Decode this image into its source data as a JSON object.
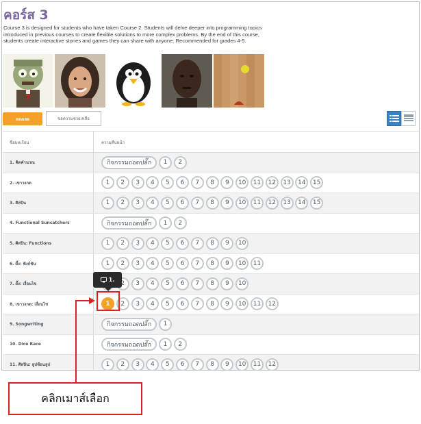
{
  "course": {
    "title": "คอร์ส 3",
    "description": "Course 3 is designed for students who have taken Course 2. Students will delve deeper into programming topics introduced in previous courses to create flexible solutions to more complex problems. By the end of this course, students create interactive stories and games they can share with anyone. Recommended for grades 4-5."
  },
  "images": [
    "zombie",
    "woman-portrait",
    "penguin",
    "man-portrait",
    "wooden-board-ball"
  ],
  "buttons": {
    "try_now": "ลองเลย",
    "help": "ขอความช่วยเหลือ"
  },
  "view_toggle": {
    "active": "list-view-icon",
    "inactive": "detail-view-icon"
  },
  "table": {
    "headers": [
      "ชื่อบทเรียน",
      "ความคืบหน้า"
    ],
    "rows": [
      {
        "name": "1. คิดคำนวณ",
        "unplugged": "กิจกรรมถอดปลั๊ก",
        "levels": [
          "1",
          "2"
        ]
      },
      {
        "name": "2. เขาวงกต",
        "levels": [
          "1",
          "2",
          "3",
          "4",
          "5",
          "6",
          "7",
          "8",
          "9",
          "10",
          "11",
          "12",
          "13",
          "14",
          "15"
        ]
      },
      {
        "name": "3. ศิลปิน",
        "levels": [
          "1",
          "2",
          "3",
          "4",
          "5",
          "6",
          "7",
          "8",
          "9",
          "10",
          "11",
          "12",
          "13",
          "14",
          "15"
        ]
      },
      {
        "name": "4. Functional Suncatchers",
        "unplugged": "กิจกรรมถอดปลั๊ก",
        "levels": [
          "1",
          "2"
        ]
      },
      {
        "name": "5. ศิลปิน: Functions",
        "levels": [
          "1",
          "2",
          "3",
          "4",
          "5",
          "6",
          "7",
          "8",
          "9",
          "10"
        ]
      },
      {
        "name": "6. ผึ้ง: ฟังก์ชัน",
        "levels": [
          "1",
          "2",
          "3",
          "4",
          "5",
          "6",
          "7",
          "8",
          "9",
          "10",
          "11"
        ]
      },
      {
        "name": "7. ผึ้ง: เงื่อนไข",
        "levels": [
          "1",
          "2",
          "3",
          "4",
          "5",
          "6",
          "7",
          "8",
          "9",
          "10"
        ]
      },
      {
        "name": "8. เขาวงกต: เงื่อนไข",
        "levels": [
          "1",
          "2",
          "3",
          "4",
          "5",
          "6",
          "7",
          "8",
          "9",
          "10",
          "11",
          "12"
        ],
        "active_level": 0
      },
      {
        "name": "9. Songwriting",
        "unplugged": "กิจกรรมถอดปลั๊ก",
        "levels": [
          "1"
        ]
      },
      {
        "name": "10. Dice Race",
        "unplugged": "กิจกรรมถอดปลั๊ก",
        "levels": [
          "1",
          "2"
        ]
      },
      {
        "name": "11. ศิลปิน: ลูปซ้อนลูป",
        "levels": [
          "1",
          "2",
          "3",
          "4",
          "5",
          "6",
          "7",
          "8",
          "9",
          "10",
          "11",
          "12"
        ]
      }
    ]
  },
  "tooltip": {
    "label": "1.",
    "icon": "monitor-icon"
  },
  "annotation": {
    "callout_text": "คลิกเมาส์เลือก",
    "color": "#e02020"
  },
  "colors": {
    "title": "#7665a0",
    "accent_orange": "#f4a12a",
    "toggle_blue": "#3a82c4"
  }
}
